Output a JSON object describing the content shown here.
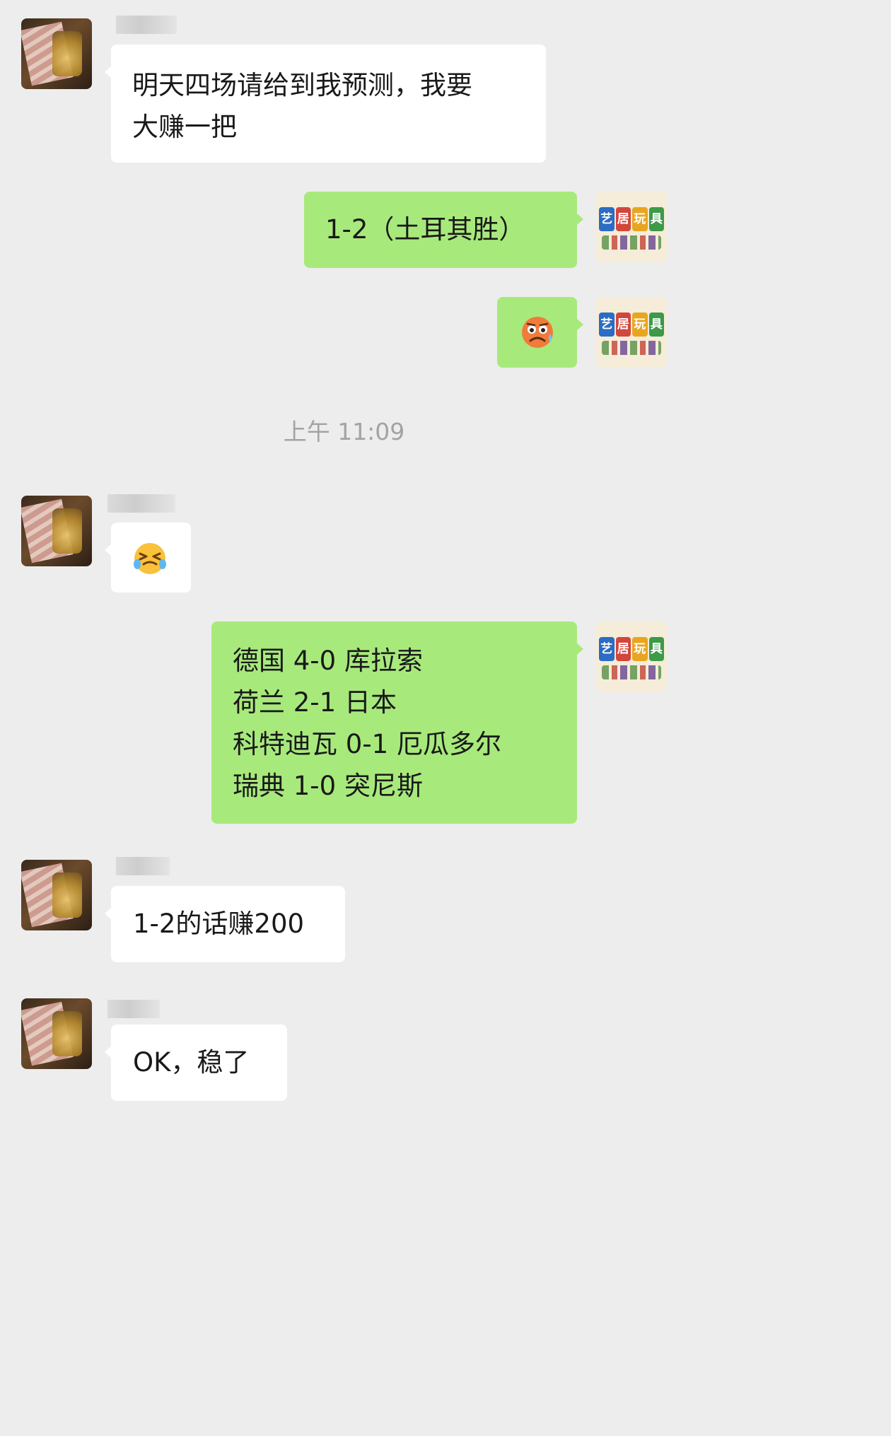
{
  "timestamp": "上午 11:09",
  "contact": {
    "avatar_icon": "whiskey-money-avatar-icon"
  },
  "self": {
    "avatar_icon": "yiju-toys-logo-icon",
    "logo_tiles": [
      "艺",
      "居",
      "玩",
      "具"
    ],
    "logo_colors": [
      "#2b6cc4",
      "#d2463c",
      "#e8a620",
      "#3c9a48"
    ]
  },
  "messages": [
    {
      "side": "left",
      "type": "text",
      "lines": [
        "明天四场请给到我预测，我要",
        "大赚一把"
      ]
    },
    {
      "side": "right",
      "type": "text",
      "lines": [
        "1-2（土耳其胜）"
      ]
    },
    {
      "side": "right",
      "type": "emoji",
      "emoji": "worried-sweat-face-icon"
    },
    {
      "side": "left",
      "type": "emoji",
      "emoji": "grinning-squint-tears-face-icon"
    },
    {
      "side": "right",
      "type": "text",
      "lines": [
        "德国 4-0 库拉索",
        "荷兰 2-1 日本",
        "科特迪瓦 0-1 厄瓜多尔",
        "瑞典 1-0 突尼斯"
      ]
    },
    {
      "side": "left",
      "type": "text",
      "lines": [
        "1-2的话赚200"
      ]
    },
    {
      "side": "left",
      "type": "text",
      "lines": [
        "OK，稳了"
      ]
    }
  ],
  "colors": {
    "background": "#ededed",
    "left_bubble": "#ffffff",
    "right_bubble": "#a8e97c",
    "timestamp_text": "#a3a3a3"
  }
}
